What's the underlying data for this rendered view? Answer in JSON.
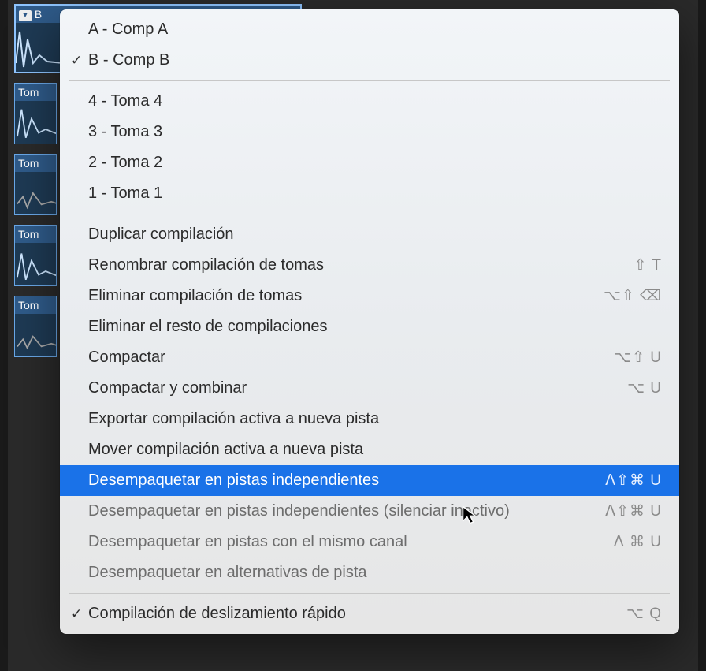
{
  "tracks": {
    "main_region_prefix": "B",
    "lanes": [
      "Tom",
      "Tom",
      "Tom",
      "Tom"
    ]
  },
  "menu": {
    "comps": [
      {
        "label": "A - Comp A",
        "checked": false
      },
      {
        "label": "B - Comp B",
        "checked": true
      }
    ],
    "takes": [
      {
        "label": "4 - Toma 4"
      },
      {
        "label": "3 - Toma 3"
      },
      {
        "label": "2 - Toma 2"
      },
      {
        "label": "1 - Toma 1"
      }
    ],
    "actions1": [
      {
        "label": "Duplicar compilación",
        "shortcut": ""
      },
      {
        "label": "Renombrar compilación de tomas",
        "shortcut": "⇧ T"
      },
      {
        "label": "Eliminar compilación de tomas",
        "shortcut": "⌥⇧ ⌫"
      },
      {
        "label": "Eliminar el resto de compilaciones",
        "shortcut": ""
      },
      {
        "label": "Compactar",
        "shortcut": "⌥⇧ U"
      },
      {
        "label": "Compactar y combinar",
        "shortcut": "⌥ U"
      },
      {
        "label": "Exportar compilación activa a nueva pista",
        "shortcut": ""
      },
      {
        "label": "Mover compilación activa a nueva pista",
        "shortcut": ""
      },
      {
        "label": "Desempaquetar en pistas independientes",
        "shortcut": "ᐱ⇧⌘ U",
        "highlighted": true
      },
      {
        "label": "Desempaquetar en pistas independientes (silenciar inactivo)",
        "shortcut": "ᐱ⇧⌘ U",
        "dim": true
      },
      {
        "label": "Desempaquetar en pistas con el mismo canal",
        "shortcut": "ᐱ ⌘ U",
        "dim": true
      },
      {
        "label": "Desempaquetar en alternativas de pista",
        "shortcut": "",
        "dim": true
      }
    ],
    "actions2": [
      {
        "label": "Compilación de deslizamiento rápido",
        "shortcut": "⌥ Q",
        "checked": true
      }
    ]
  }
}
